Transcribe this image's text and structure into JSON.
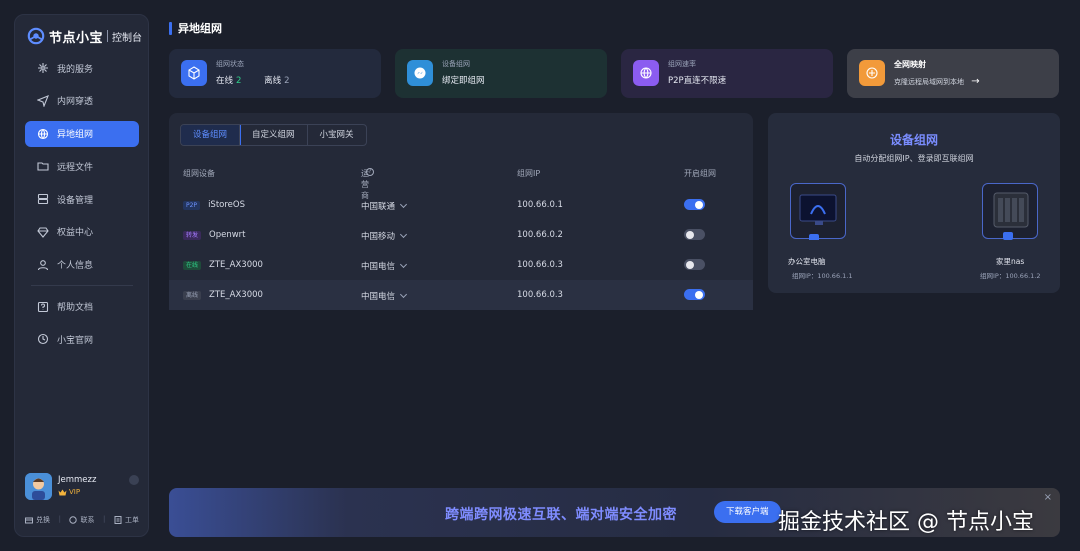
{
  "brand": {
    "name": "节点小宝",
    "subtitle": "控制台"
  },
  "nav": [
    {
      "label": "我的服务",
      "icon": "service-icon"
    },
    {
      "label": "内网穿透",
      "icon": "send-icon"
    },
    {
      "label": "异地组网",
      "icon": "network-icon",
      "active": true
    },
    {
      "label": "远程文件",
      "icon": "folder-icon"
    },
    {
      "label": "设备管理",
      "icon": "device-icon"
    },
    {
      "label": "权益中心",
      "icon": "diamond-icon"
    },
    {
      "label": "个人信息",
      "icon": "user-icon"
    },
    {
      "label": "帮助文档",
      "icon": "help-icon"
    },
    {
      "label": "小宝官网",
      "icon": "globe-icon"
    }
  ],
  "user": {
    "name": "Jemmezz",
    "badge": "VIP"
  },
  "user_links": {
    "redeem": "兑换",
    "contact": "联系",
    "ticket": "工单"
  },
  "page_title": "异地组网",
  "cards": {
    "status": {
      "label": "组网状态",
      "online_label": "在线",
      "online": "2",
      "offline_label": "离线",
      "offline": "2"
    },
    "device": {
      "label": "设备组网",
      "value": "绑定即组网"
    },
    "speed": {
      "label": "组网速率",
      "value": "P2P直连不限速"
    },
    "mapping": {
      "label": "全网映射",
      "value": "克隆远程局域网到本地"
    }
  },
  "tabs": [
    "设备组网",
    "自定义组网",
    "小宝网关"
  ],
  "table": {
    "headers": {
      "device": "组网设备",
      "isp": "运营商",
      "ip": "组网IP",
      "enable": "开启组网"
    },
    "rows": [
      {
        "tag": "P2P",
        "name": "iStoreOS",
        "isp": "中国联通",
        "ip": "100.66.0.1",
        "on": true
      },
      {
        "tag": "转发",
        "name": "Openwrt",
        "isp": "中国移动",
        "ip": "100.66.0.2",
        "on": false
      },
      {
        "tag": "在线",
        "name": "ZTE_AX3000",
        "isp": "中国电信",
        "ip": "100.66.0.3",
        "on": false
      },
      {
        "tag": "离线",
        "name": "ZTE_AX3000",
        "isp": "中国电信",
        "ip": "100.66.0.3",
        "on": true
      }
    ]
  },
  "illustration": {
    "title": "设备组网",
    "subtitle": "自动分配组网IP、登录即互联组网",
    "left_name": "办公室电脑",
    "left_ip": "组网IP：100.66.1.1",
    "right_name": "家里nas",
    "right_ip": "组网IP：100.66.1.2"
  },
  "banner": {
    "text": "跨端跨网极速互联、端对端安全加密",
    "button": "下载客户端",
    "close": "×"
  },
  "watermark": "掘金技术社区 @ 节点小宝",
  "colors": {
    "accent": "#3b6ff0",
    "online": "#2fd089",
    "vip": "#f3b33c"
  }
}
